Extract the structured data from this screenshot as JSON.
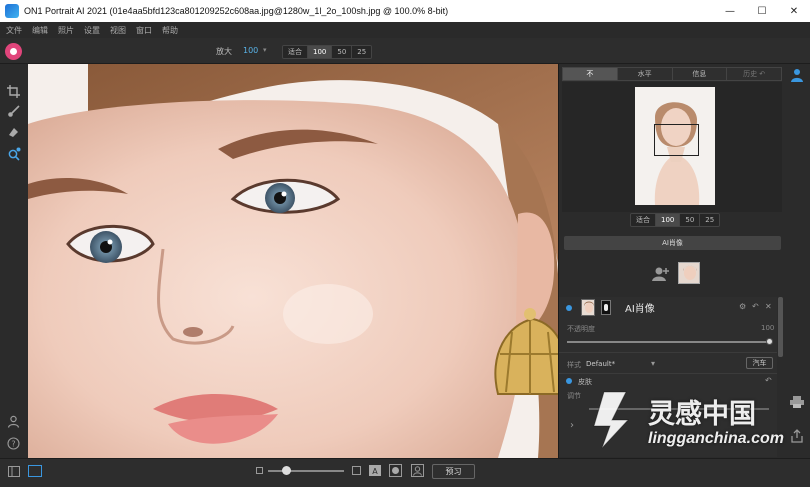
{
  "window": {
    "title": "ON1 Portrait AI 2021 (01e4aa5bfd123ca801209252c608aa.jpg@1280w_1l_2o_100sh.jpg @ 100.0% 8-bit)",
    "minimize": "—",
    "maximize": "☐",
    "close": "✕"
  },
  "menu": [
    "文件",
    "编辑",
    "照片",
    "设置",
    "视图",
    "窗口",
    "帮助"
  ],
  "toolbar": {
    "zoom_label": "放大",
    "zoom_value": "100",
    "zoom_options": [
      "适合",
      "100",
      "50",
      "25"
    ],
    "zoom_active": "100"
  },
  "panel": {
    "tabs": [
      "不",
      "水平",
      "信息",
      "历史"
    ],
    "active_tab": "不",
    "nav_zoom_options": [
      "适合",
      "100",
      "50",
      "25"
    ],
    "ai_portrait_button": "AI肖像",
    "layer": {
      "title": "AI肖像",
      "opacity_label": "不透明度",
      "opacity_value": "100",
      "style_label": "样式",
      "style_value": "Default*",
      "auto_button": "汽车",
      "skin_label": "皮肤",
      "sub_label": "调节"
    }
  },
  "bottom": {
    "preview_button": "预习"
  },
  "watermark": {
    "cn": "灵感中国",
    "en": "lingganchina.com"
  },
  "colors": {
    "accent": "#3a97e0",
    "avatar": "#e0457b",
    "panel_bg": "#2b2b2b"
  }
}
